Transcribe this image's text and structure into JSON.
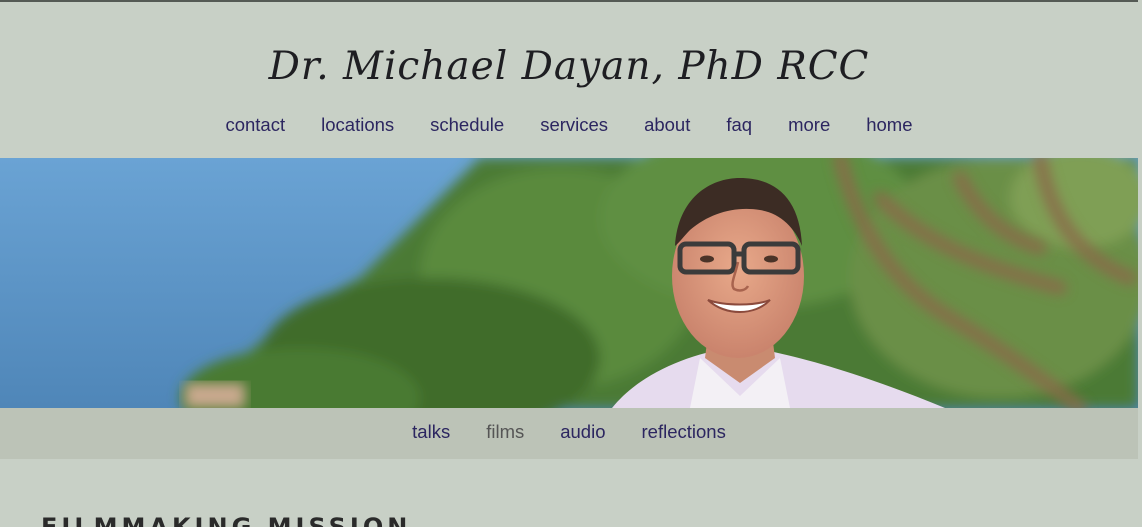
{
  "site": {
    "title": "Dr. Michael Dayan, PhD RCC"
  },
  "main_nav": {
    "items": [
      "contact",
      "locations",
      "schedule",
      "services",
      "about",
      "faq",
      "more",
      "home"
    ]
  },
  "sub_nav": {
    "items": [
      "talks",
      "films",
      "audio",
      "reflections"
    ],
    "active": "films"
  },
  "content": {
    "heading": "FILMMAKING MISSION"
  },
  "colors": {
    "background": "#c8d0c6",
    "subnav_background": "#bcc3b7",
    "link": "#2c2660",
    "active_link": "#555555",
    "sky": "#5d93c2",
    "foliage": "#4f7a35"
  },
  "hero_image": {
    "icon": "portrait-photo"
  }
}
